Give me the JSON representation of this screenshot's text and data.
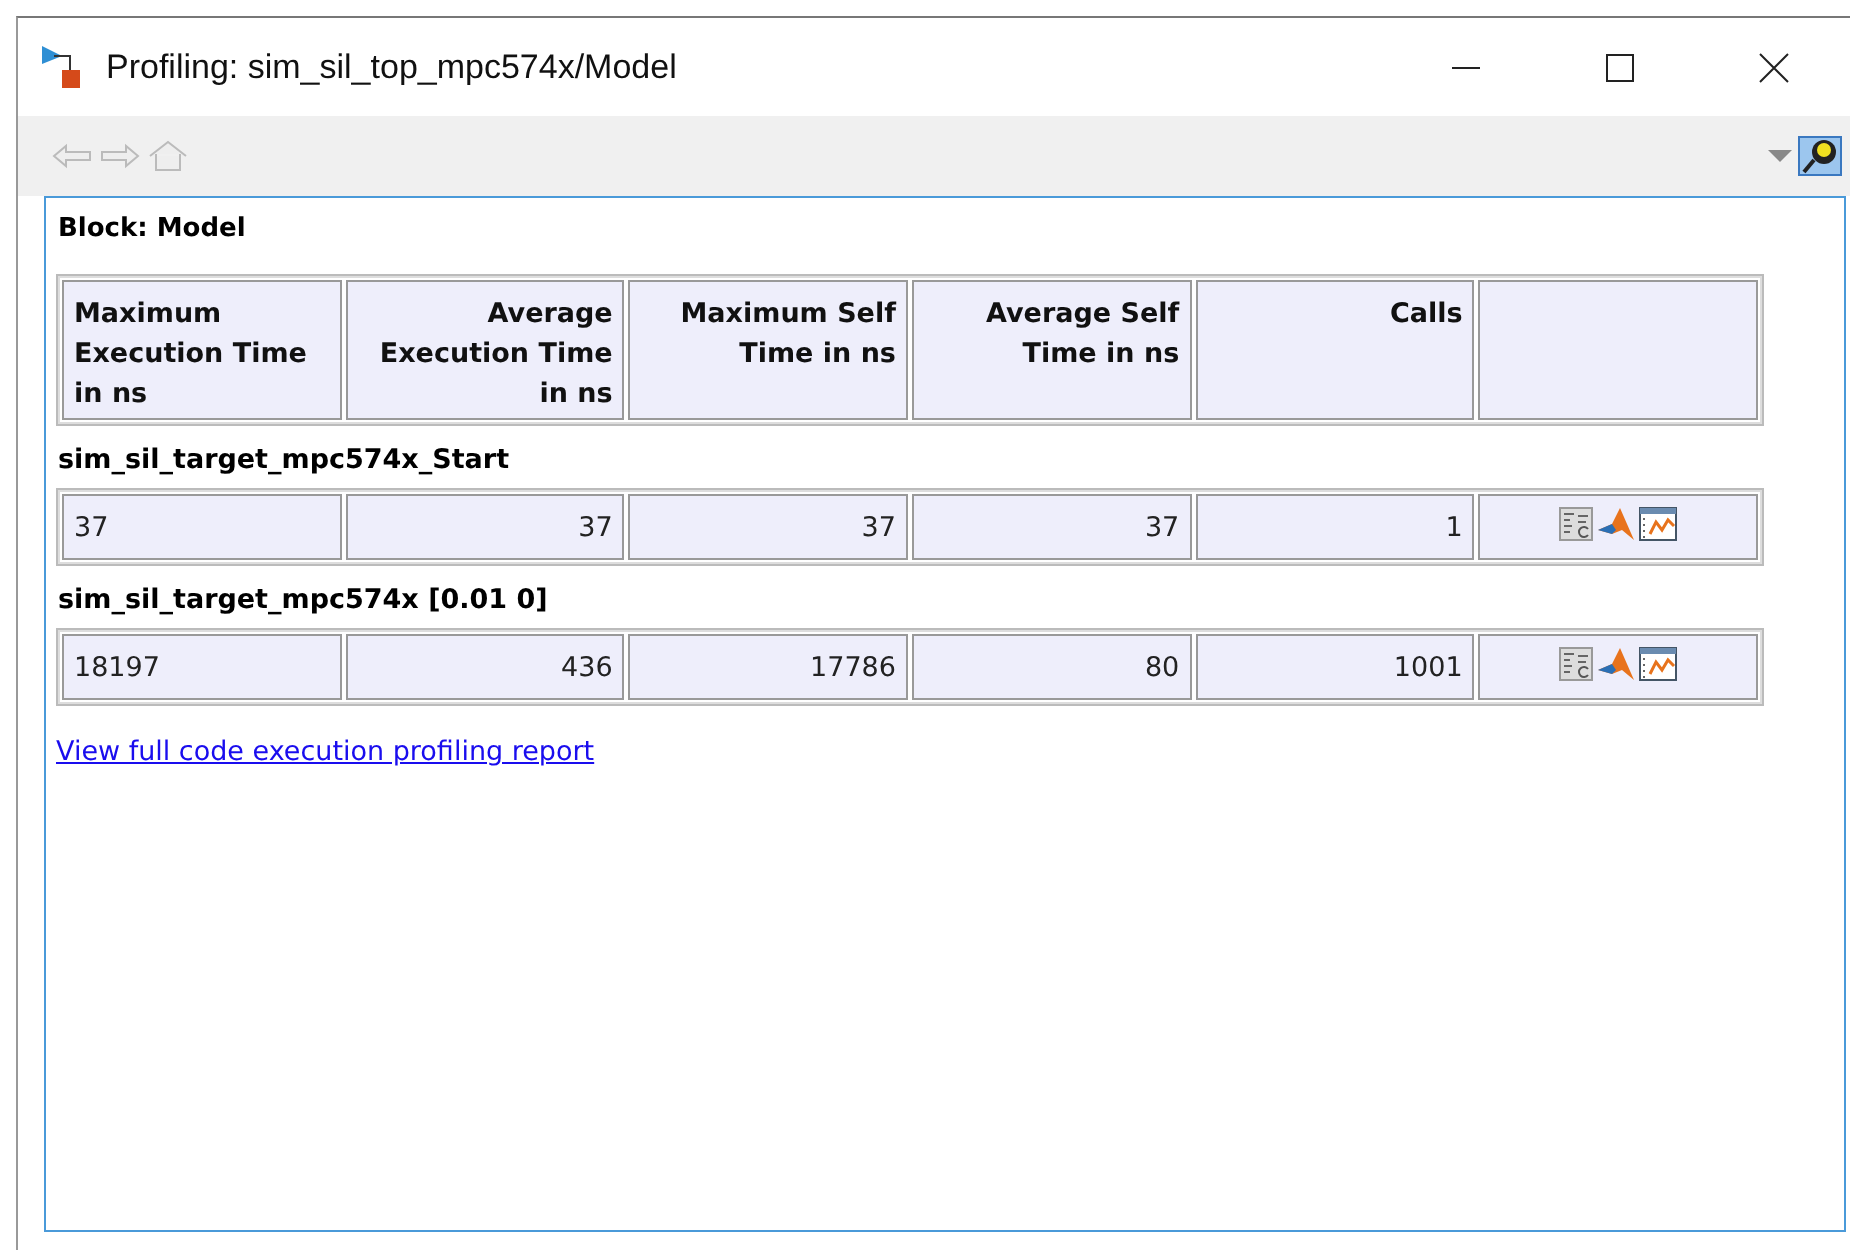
{
  "window": {
    "title": "Profiling: sim_sil_top_mpc574x/Model"
  },
  "block_label": "Block: Model",
  "header": {
    "columns": [
      "Maximum Execution Time in ns",
      "Average Execution Time in ns",
      "Maximum Self Time in ns",
      "Average Self Time in ns",
      "Calls"
    ]
  },
  "sections": [
    {
      "name": "sim_sil_target_mpc574x_Start",
      "cells": [
        "37",
        "37",
        "37",
        "37",
        "1"
      ]
    },
    {
      "name": "sim_sil_target_mpc574x [0.01 0]",
      "cells": [
        "18197",
        "436",
        "17786",
        "80",
        "1001"
      ]
    }
  ],
  "link": "View full code execution profiling report"
}
